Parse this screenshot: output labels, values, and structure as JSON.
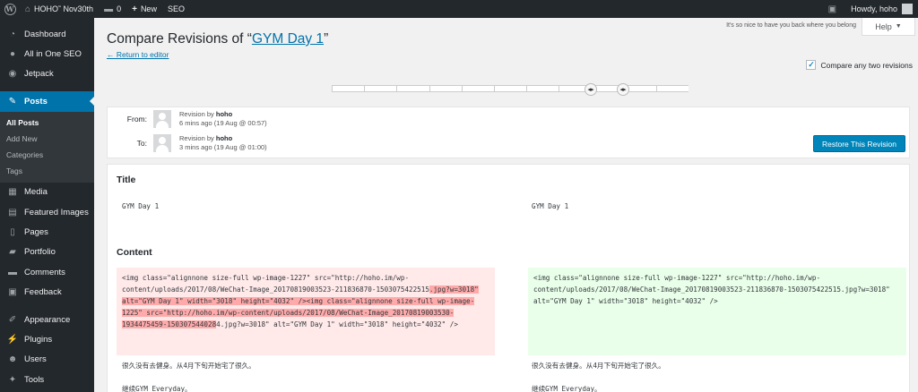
{
  "adminbar": {
    "site_name": "HOHO˜ Nov30th",
    "comments_count": "0",
    "new_label": "New",
    "seo_label": "SEO",
    "howdy": "Howdy, hoho"
  },
  "sidebar": {
    "items_top": [
      {
        "label": "Dashboard",
        "icon": "dashboard-icon"
      },
      {
        "label": "All in One SEO",
        "icon": "seo-icon"
      },
      {
        "label": "Jetpack",
        "icon": "jetpack-icon"
      }
    ],
    "posts_label": "Posts",
    "posts_sub": [
      "All Posts",
      "Add New",
      "Categories",
      "Tags"
    ],
    "items_mid": [
      {
        "label": "Media",
        "icon": "media-icon"
      },
      {
        "label": "Featured Images",
        "icon": "featured-images-icon"
      },
      {
        "label": "Pages",
        "icon": "pages-icon"
      },
      {
        "label": "Portfolio",
        "icon": "portfolio-icon"
      },
      {
        "label": "Comments",
        "icon": "comments-icon"
      },
      {
        "label": "Feedback",
        "icon": "feedback-icon"
      }
    ],
    "items_bottom": [
      {
        "label": "Appearance",
        "icon": "appearance-icon"
      },
      {
        "label": "Plugins",
        "icon": "plugins-icon"
      },
      {
        "label": "Users",
        "icon": "users-icon"
      },
      {
        "label": "Tools",
        "icon": "tools-icon"
      }
    ]
  },
  "main": {
    "nice_message": "It's so nice to have you back where you belong",
    "help_label": "Help",
    "title_prefix": "Compare Revisions of “",
    "title_link": "GYM Day 1",
    "title_suffix": "”",
    "back_link": "← Return to editor",
    "compare_label": "Compare any two revisions",
    "compare_checked": true,
    "slider_ticks": 11,
    "from": {
      "label": "From:",
      "byline_prefix": "Revision by ",
      "author": "hoho",
      "time": "6 mins ago (19 Aug @ 00:57)"
    },
    "to": {
      "label": "To:",
      "byline_prefix": "Revision by ",
      "author": "hoho",
      "time": "3 mins ago (19 Aug @ 01:00)"
    },
    "restore_label": "Restore This Revision",
    "diff": {
      "title_heading": "Title",
      "title_left": "GYM Day 1",
      "title_right": "GYM Day 1",
      "content_heading": "Content",
      "left_code_1": "<img class=\"alignnone size-full wp-image-1227\" src=\"http://hoho.im/wp-content/uploads/2017/08/WeChat-Image_20170819003523-211836870-1503075422515",
      "left_del_1": ".jpg?w=3018\" alt=\"GYM Day 1\" width=\"3018\" height=\"4032\" />",
      "left_del_2": "<img class=\"alignnone size-full wp-image-1225\" src=\"http://hoho.im/wp-content/uploads/2017/08/WeChat-Image_20170819003530-1934475459-150307544028",
      "left_code_2": "4.jpg?w=3018\" alt=\"GYM Day 1\" width=\"3018\" height=\"4032\" />",
      "right_code": "<img class=\"alignnone size-full wp-image-1227\" src=\"http://hoho.im/wp-content/uploads/2017/08/WeChat-Image_20170819003523-211836870-1503075422515.jpg?w=3018\" alt=\"GYM Day 1\" width=\"3018\" height=\"4032\" />",
      "line_cn_1": "很久没有去健身。从4月下旬开始宅了很久。",
      "line_cn_2": "继续GYM Everyday。"
    }
  },
  "colors": {
    "admin_dark": "#23282d",
    "accent_blue": "#0073aa",
    "button_blue": "#0085ba",
    "deleted_bg": "#ffe9e9",
    "deleted_highlight": "#ffaaaa",
    "added_bg": "#e9ffe9"
  }
}
